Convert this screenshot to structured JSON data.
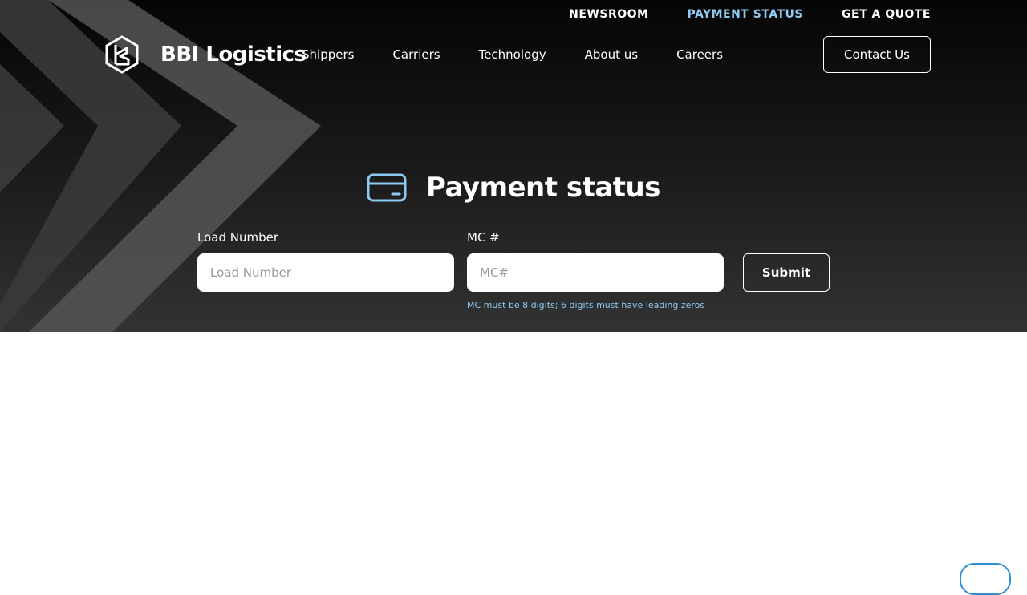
{
  "brand": {
    "name": "BBI Logistics",
    "logo_icon": "bbi-hexagon-logo-icon"
  },
  "topbar": {
    "items": [
      {
        "label": "NEWSROOM",
        "active": false
      },
      {
        "label": "PAYMENT STATUS",
        "active": true
      },
      {
        "label": "GET A QUOTE",
        "active": false
      }
    ]
  },
  "nav": {
    "items": [
      {
        "label": "Shippers"
      },
      {
        "label": "Carriers"
      },
      {
        "label": "Technology"
      },
      {
        "label": "About us"
      },
      {
        "label": "Careers"
      }
    ],
    "contact_label": "Contact Us"
  },
  "page": {
    "title": "Payment status",
    "title_icon": "credit-card-icon"
  },
  "form": {
    "load_number": {
      "label": "Load Number",
      "placeholder": "Load Number",
      "value": ""
    },
    "mc": {
      "label": "MC #",
      "placeholder": "MC#",
      "value": "",
      "hint": "MC must be 8 digits; 6 digits must have leading zeros"
    },
    "submit_label": "Submit"
  },
  "colors": {
    "accent": "#8ec9f2",
    "hero_top": "#050505",
    "hero_bottom": "#333333",
    "chat_border": "#2f8fd3"
  }
}
